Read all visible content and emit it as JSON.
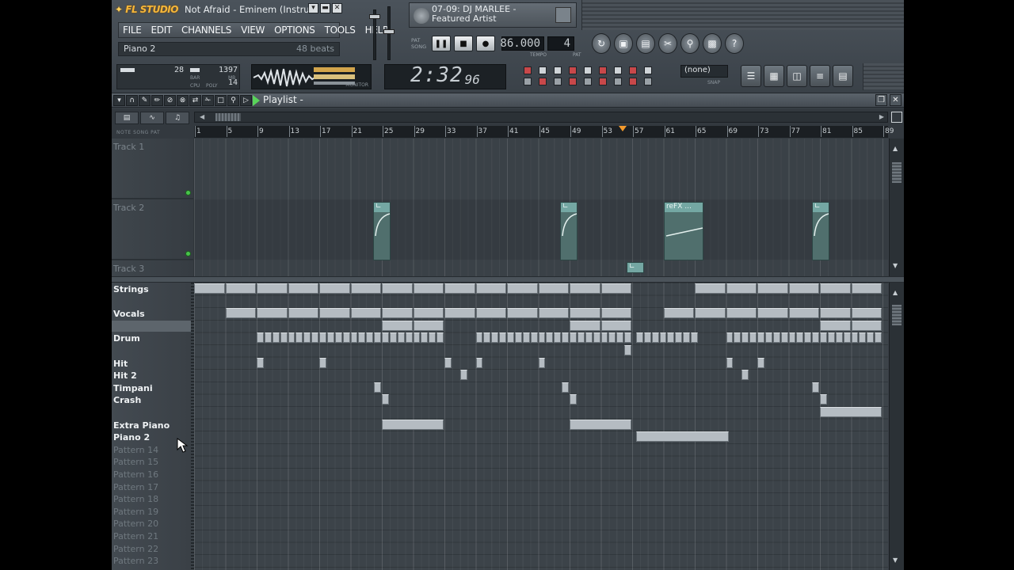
{
  "app": {
    "logo_text": "FL STUDIO",
    "song_title": "Not Afraid - Eminem (Instrum...",
    "menu": [
      "FILE",
      "EDIT",
      "CHANNELS",
      "VIEW",
      "OPTIONS",
      "TOOLS",
      "HELP"
    ],
    "hint_left": "Piano 2",
    "hint_right": "48 beats"
  },
  "song_panel": {
    "text": "07-09: DJ MARLEE - Featured Artist"
  },
  "transport": {
    "pat_label": "PAT",
    "song_label": "SONG",
    "pause_icon": "pause-icon",
    "stop_icon": "stop-icon",
    "record_icon": "record-icon",
    "tempo": "86.000",
    "tempo_label": "TEMPO",
    "pattern_num": "4",
    "pattern_label": "PAT"
  },
  "meters": {
    "bar_val": "28",
    "mb_val": "1397",
    "poly_val": "14",
    "bar_label": "BAR",
    "cpu_label": "CPU",
    "poly_label": "POLY",
    "mb_label": "MB",
    "monitor_label": "MONITOR"
  },
  "clock": {
    "time": "2:32",
    "sub": "96"
  },
  "snap": {
    "value": "(none)",
    "label": "SNAP"
  },
  "playlist": {
    "title": "Playlist -",
    "mode_labels": "NOTE  SONG  PAT",
    "ruler": [
      "1",
      "5",
      "9",
      "13",
      "17",
      "21",
      "25",
      "29",
      "33",
      "37",
      "41",
      "45",
      "49",
      "53",
      "57",
      "61",
      "65",
      "69",
      "73",
      "77",
      "81",
      "85",
      "89"
    ],
    "tracks": [
      "Track 1",
      "Track 2",
      "Track 3"
    ],
    "clip_label": "reFX ...",
    "patterns": [
      {
        "name": "Strings",
        "empty": false
      },
      {
        "name": "",
        "empty": false
      },
      {
        "name": "Vocals",
        "empty": false
      },
      {
        "name": "",
        "empty": false
      },
      {
        "name": "Drum",
        "empty": false
      },
      {
        "name": "",
        "empty": false
      },
      {
        "name": "Hit",
        "empty": false
      },
      {
        "name": "Hit 2",
        "empty": false
      },
      {
        "name": "Timpani",
        "empty": false
      },
      {
        "name": "Crash",
        "empty": false
      },
      {
        "name": "",
        "empty": false
      },
      {
        "name": "Extra Piano",
        "empty": false
      },
      {
        "name": "Piano 2",
        "empty": false
      },
      {
        "name": "Pattern 14",
        "empty": true
      },
      {
        "name": "Pattern 15",
        "empty": true
      },
      {
        "name": "Pattern 16",
        "empty": true
      },
      {
        "name": "Pattern 17",
        "empty": true
      },
      {
        "name": "Pattern 18",
        "empty": true
      },
      {
        "name": "Pattern 19",
        "empty": true
      },
      {
        "name": "Pattern 20",
        "empty": true
      },
      {
        "name": "Pattern 21",
        "empty": true
      },
      {
        "name": "Pattern 22",
        "empty": true
      },
      {
        "name": "Pattern 23",
        "empty": true
      }
    ]
  },
  "icons": {
    "close": "close-icon",
    "cursor": "hand-cursor-icon"
  }
}
